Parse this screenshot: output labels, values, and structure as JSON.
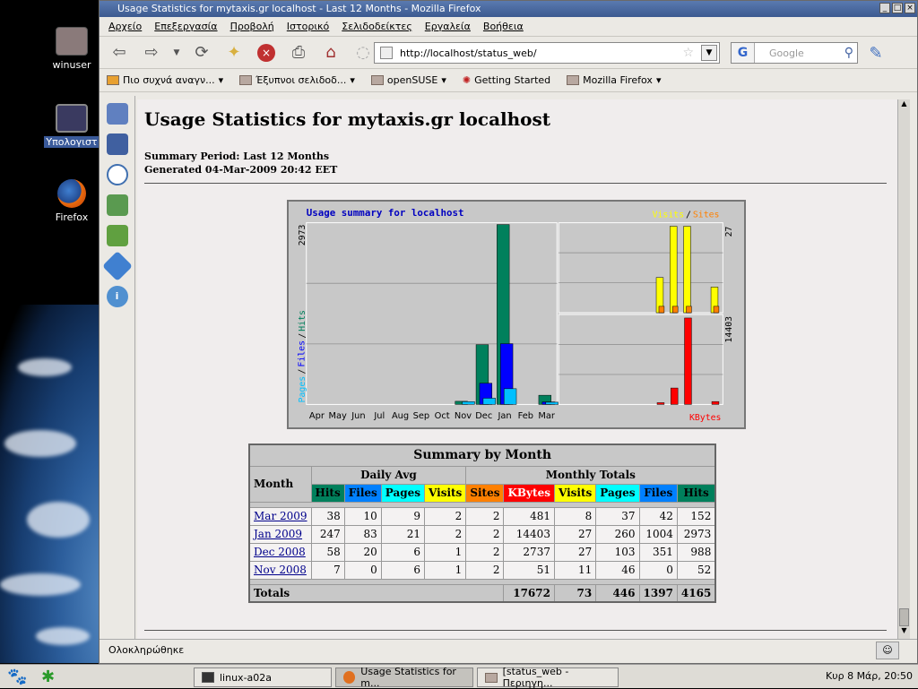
{
  "desktop": {
    "icons": [
      {
        "label": "winuser"
      },
      {
        "label": "Υπολογιστ"
      },
      {
        "label": "Firefox"
      }
    ]
  },
  "window": {
    "title": "Usage Statistics for mytaxis.gr localhost - Last 12 Months - Mozilla Firefox",
    "menu": [
      "Αρχείο",
      "Επεξεργασία",
      "Προβολή",
      "Ιστορικό",
      "Σελιδοδείκτες",
      "Εργαλεία",
      "Βοήθεια"
    ],
    "url": "http://localhost/status_web/",
    "search_placeholder": "Google",
    "bookmarks": [
      "Πιο συχνά αναγν...",
      "Έξυπνοι σελιδοδ...",
      "openSUSE",
      "Getting Started",
      "Mozilla Firefox"
    ],
    "status_text": "Ολοκληρώθηκε"
  },
  "page": {
    "title": "Usage Statistics for mytaxis.gr localhost",
    "summary_period": "Summary Period: Last 12 Months",
    "generated": "Generated 04-Mar-2009 20:42 EET"
  },
  "chart_data": {
    "type": "bar",
    "title": "Usage summary for localhost",
    "categories": [
      "Apr",
      "May",
      "Jun",
      "Jul",
      "Aug",
      "Sep",
      "Oct",
      "Nov",
      "Dec",
      "Jan",
      "Feb",
      "Mar"
    ],
    "left_panel": {
      "ylabel": [
        "Pages",
        "Files",
        "Hits"
      ],
      "max_label": "2973",
      "ymax": 2973,
      "series": [
        {
          "name": "Hits",
          "color": "#00805c",
          "values": [
            0,
            0,
            0,
            0,
            0,
            0,
            0,
            52,
            988,
            2973,
            0,
            152
          ]
        },
        {
          "name": "Files",
          "color": "#0000ff",
          "values": [
            0,
            0,
            0,
            0,
            0,
            0,
            0,
            0,
            351,
            1004,
            0,
            42
          ]
        },
        {
          "name": "Pages",
          "color": "#00c0ff",
          "values": [
            0,
            0,
            0,
            0,
            0,
            0,
            0,
            46,
            103,
            260,
            0,
            37
          ]
        }
      ]
    },
    "top_right_panel": {
      "legend": [
        "Visits",
        "Sites"
      ],
      "max_label": "27",
      "ymax": 27,
      "series": [
        {
          "name": "Visits",
          "color": "#ffff00",
          "values": [
            0,
            0,
            0,
            0,
            0,
            0,
            0,
            11,
            27,
            27,
            0,
            8
          ]
        },
        {
          "name": "Sites",
          "color": "#ff8000",
          "values": [
            0,
            0,
            0,
            0,
            0,
            0,
            0,
            2,
            2,
            2,
            0,
            2
          ]
        }
      ]
    },
    "bottom_right_panel": {
      "legend": "KBytes",
      "max_label": "14403",
      "ymax": 14403,
      "series": [
        {
          "name": "KBytes",
          "color": "#ff0000",
          "values": [
            0,
            0,
            0,
            0,
            0,
            0,
            0,
            51,
            2737,
            14403,
            0,
            481
          ]
        }
      ]
    }
  },
  "table": {
    "caption": "Summary by Month",
    "month_header": "Month",
    "daily_avg_header": "Daily Avg",
    "monthly_totals_header": "Monthly Totals",
    "subheaders": [
      {
        "label": "Hits",
        "color": "#00805c"
      },
      {
        "label": "Files",
        "color": "#0080ff"
      },
      {
        "label": "Pages",
        "color": "#00ffff"
      },
      {
        "label": "Visits",
        "color": "#ffff00"
      },
      {
        "label": "Sites",
        "color": "#ff8000"
      },
      {
        "label": "KBytes",
        "color": "#ff0000"
      },
      {
        "label": "Visits",
        "color": "#ffff00"
      },
      {
        "label": "Pages",
        "color": "#00ffff"
      },
      {
        "label": "Files",
        "color": "#0080ff"
      },
      {
        "label": "Hits",
        "color": "#00805c"
      }
    ],
    "rows": [
      {
        "month": "Mar 2009",
        "values": [
          "38",
          "10",
          "9",
          "2",
          "2",
          "481",
          "8",
          "37",
          "42",
          "152"
        ]
      },
      {
        "month": "Jan 2009",
        "values": [
          "247",
          "83",
          "21",
          "2",
          "2",
          "14403",
          "27",
          "260",
          "1004",
          "2973"
        ]
      },
      {
        "month": "Dec 2008",
        "values": [
          "58",
          "20",
          "6",
          "1",
          "2",
          "2737",
          "27",
          "103",
          "351",
          "988"
        ]
      },
      {
        "month": "Nov 2008",
        "values": [
          "7",
          "0",
          "6",
          "1",
          "2",
          "51",
          "11",
          "46",
          "0",
          "52"
        ]
      }
    ],
    "totals": {
      "label": "Totals",
      "values": [
        "17672",
        "73",
        "446",
        "1397",
        "4165"
      ]
    }
  },
  "taskbar": {
    "tasks": [
      "linux-a02a",
      "Usage Statistics for m...",
      "[status_web - Περιηγη..."
    ],
    "clock": "Κυρ  8 Μάρ, 20:50"
  }
}
